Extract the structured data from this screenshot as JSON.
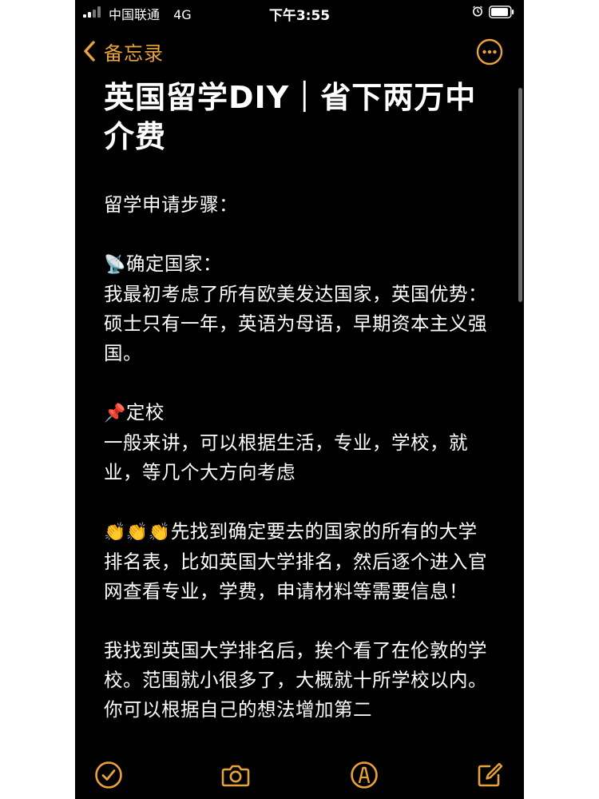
{
  "status_bar": {
    "carrier": "中国联通",
    "network": "4G",
    "time": "下午3:55",
    "alarm_icon": "alarm-clock-icon",
    "battery_icon": "battery-icon"
  },
  "nav": {
    "back_label": "备忘录",
    "back_icon": "chevron-left-icon",
    "more_icon": "ellipsis-circle-icon"
  },
  "note": {
    "title": "英国留学DIY｜省下两万中介费",
    "intro": "留学申请步骤：",
    "sections": [
      {
        "emoji": "📡",
        "heading": "确定国家：",
        "body": "我最初考虑了所有欧美发达国家，英国优势：硕士只有一年，英语为母语，早期资本主义强国。"
      },
      {
        "emoji": "📌",
        "heading": "定校",
        "body": "一般来讲，可以根据生活，专业，学校，就业，等几个大方向考虑"
      }
    ],
    "clap_emoji": "👏👏👏",
    "clap_text": "先找到确定要去的国家的所有的大学排名表，比如英国大学排名，然后逐个进入官网查看专业，学费，申请材料等需要信息！",
    "paragraph_last": "我找到英国大学排名后，挨个看了在伦敦的学校。范围就小很多了，大概就十所学校以内。你可以根据自己的想法增加第二"
  },
  "toolbar": {
    "checklist_icon": "checklist-icon",
    "camera_icon": "camera-icon",
    "markup_icon": "markup-pen-icon",
    "compose_icon": "compose-icon"
  },
  "colors": {
    "accent": "#e8a33b",
    "background": "#000000",
    "text": "#ffffff"
  }
}
